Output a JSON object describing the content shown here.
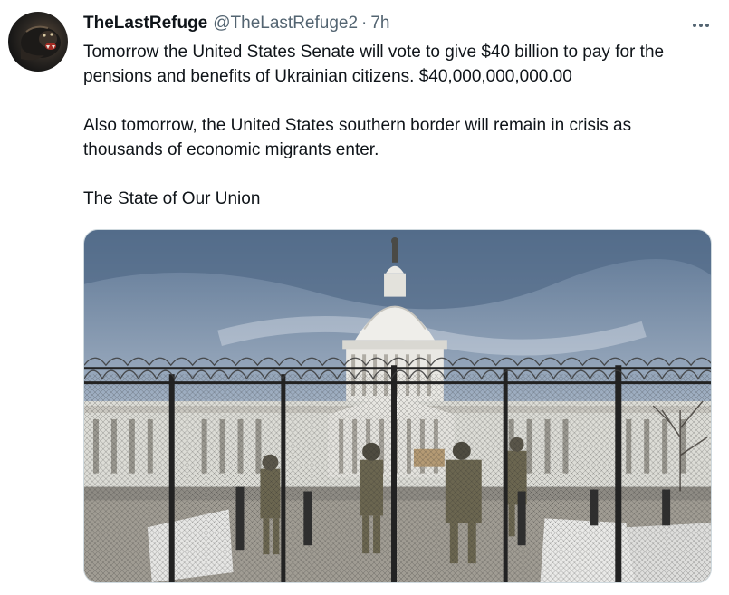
{
  "tweet": {
    "author_name": "TheLastRefuge",
    "author_handle": "@TheLastRefuge2",
    "separator": "·",
    "time": "7h",
    "paragraphs": [
      "Tomorrow the United States Senate will vote to give $40 billion to pay for the pensions and benefits of Ukrainian citizens. $40,000,000,000.00",
      "Also tomorrow, the United States southern border will remain in crisis as thousands of economic migrants enter.",
      "The State of Our Union"
    ]
  },
  "icons": {
    "avatar": "profile-photo",
    "more": "more-icon"
  },
  "colors": {
    "text": "#0f1419",
    "secondary": "#536471",
    "border": "#cfd9de"
  }
}
